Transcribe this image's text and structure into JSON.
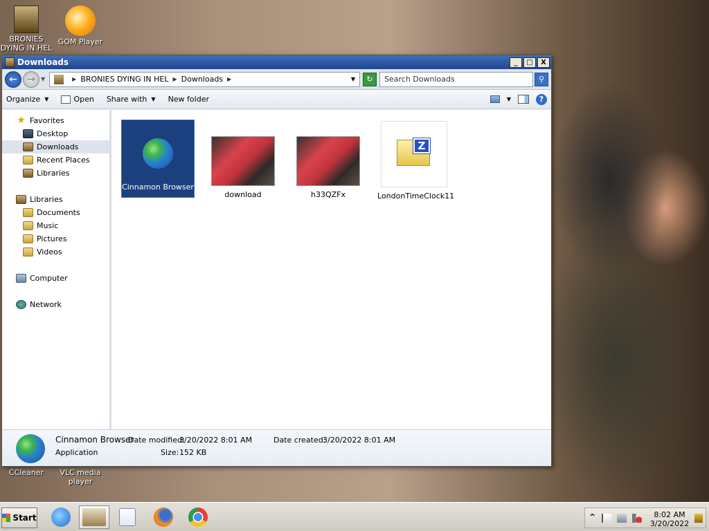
{
  "desktop": {
    "icons": [
      {
        "label": "BRONIES DYING IN HEL"
      },
      {
        "label": "GOM Player"
      },
      {
        "label": "CCleaner"
      },
      {
        "label": "VLC media player"
      }
    ]
  },
  "window": {
    "title": "Downloads",
    "controls": {
      "minimize": "_",
      "maximize": "□",
      "close": "X"
    },
    "address": {
      "crumbs": [
        "BRONIES DYING IN HEL",
        "Downloads"
      ],
      "search_placeholder": "Search Downloads"
    },
    "commands": {
      "organize": "Organize",
      "open": "Open",
      "share_with": "Share with",
      "new_folder": "New folder"
    },
    "nav": {
      "favorites": "Favorites",
      "favorites_items": [
        "Desktop",
        "Downloads",
        "Recent Places",
        "Libraries"
      ],
      "libraries": "Libraries",
      "libraries_items": [
        "Documents",
        "Music",
        "Pictures",
        "Videos"
      ],
      "computer": "Computer",
      "network": "Network"
    },
    "files": [
      {
        "name": "Cinnamon Browser",
        "kind": "globe-icon",
        "selected": true
      },
      {
        "name": "download",
        "kind": "photo",
        "selected": false
      },
      {
        "name": "h33QZFx",
        "kind": "photo",
        "selected": false
      },
      {
        "name": "LondonTimeClock11",
        "kind": "zip-icon",
        "selected": false
      }
    ],
    "details": {
      "name": "Cinnamon Browser",
      "type": "Application",
      "date_modified_label": "Date modified:",
      "date_modified": "3/20/2022 8:01 AM",
      "date_created_label": "Date created:",
      "date_created": "3/20/2022 8:01 AM",
      "size_label": "Size:",
      "size": "152 KB"
    }
  },
  "taskbar": {
    "start_label": "Start",
    "apps": [
      "internet-explorer-icon",
      "windows-explorer-icon",
      "media-player-icon",
      "firefox-icon",
      "chrome-icon"
    ],
    "clock_time": "8:02 AM",
    "clock_date": "3/20/2022",
    "tray_expand": "^"
  }
}
